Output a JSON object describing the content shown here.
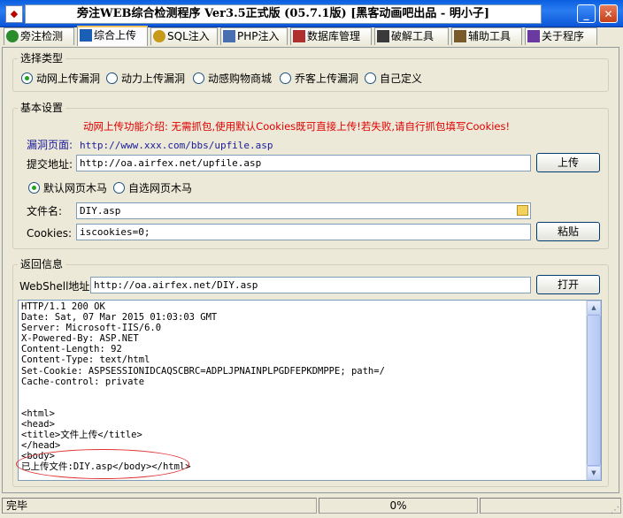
{
  "window": {
    "title": "旁注WEB综合检测程序 Ver3.5正式版 (05.7.1版) [黑客动画吧出品 - 明小子]",
    "app_icon": "shield-icon",
    "minimize_glyph": "_",
    "close_glyph": "✕"
  },
  "tabs": [
    {
      "label": "旁注检测",
      "icon": "globe-icon",
      "color": "#2a8c2a"
    },
    {
      "label": "综合上传",
      "icon": "chart-icon",
      "color": "#1a5fb4"
    },
    {
      "label": "SQL注入",
      "icon": "magnifier-icon",
      "color": "#c89a1a"
    },
    {
      "label": "PHP注入",
      "icon": "page-icon",
      "color": "#4a6fb0"
    },
    {
      "label": "数据库管理",
      "icon": "database-icon",
      "color": "#b03030"
    },
    {
      "label": "破解工具",
      "icon": "keyboard-icon",
      "color": "#3a3a3a"
    },
    {
      "label": "辅助工具",
      "icon": "clipboard-icon",
      "color": "#7a5a2a"
    },
    {
      "label": "关于程序",
      "icon": "book-icon",
      "color": "#6a3aa0"
    }
  ],
  "type_group": {
    "legend": "选择类型",
    "options": [
      "动网上传漏洞",
      "动力上传漏洞",
      "动感购物商城",
      "乔客上传漏洞",
      "自己定义"
    ],
    "selected_index": 0
  },
  "basic": {
    "legend": "基本设置",
    "intro": "动网上传功能介绍: 无需抓包,使用默认Cookies既可直接上传!若失败,请自行抓包填写Cookies!",
    "vuln_page_label": "漏洞页面:",
    "vuln_page_url": "http://www.xxx.com/bbs/upfile.asp",
    "submit_label": "提交地址:",
    "submit_value": "http://oa.airfex.net/upfile.asp",
    "upload_button": "上传",
    "trojan_options": [
      "默认网页木马",
      "自选网页木马"
    ],
    "trojan_selected_index": 0,
    "filename_label": "文件名:",
    "filename_value": "DIY.asp",
    "cookies_label": "Cookies:",
    "cookies_value": "iscookies=0;",
    "paste_button": "粘贴"
  },
  "result": {
    "legend": "返回信息",
    "webshell_label": "WebShell地址:",
    "webshell_value": "http://oa.airfex.net/DIY.asp",
    "open_button": "打开",
    "response_text": "HTTP/1.1 200 OK\nDate: Sat, 07 Mar 2015 01:03:03 GMT\nServer: Microsoft-IIS/6.0\nX-Powered-By: ASP.NET\nContent-Length: 92\nContent-Type: text/html\nSet-Cookie: ASPSESSIONIDCAQSCBRC=ADPLJPNAINPLPGDFEPKDMPPE; path=/\nCache-control: private\n\n\n<html>\n<head>\n<title>文件上传</title>\n</head>\n<body>\n已上传文件:DIY.asp</body></html>"
  },
  "status": {
    "message": "完毕",
    "middle": "",
    "progress": "0%",
    "right": ""
  }
}
